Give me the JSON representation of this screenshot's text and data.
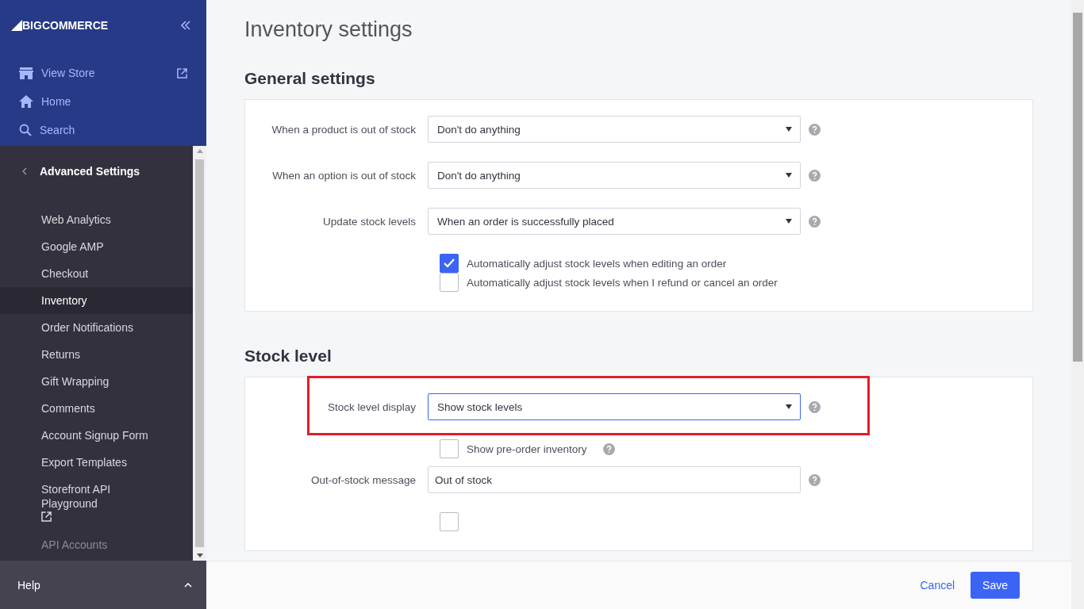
{
  "sidebar": {
    "logo": {
      "mark": "BIG",
      "word": "COMMERCE"
    },
    "top_links": [
      {
        "kind": "store",
        "label": "View Store"
      },
      {
        "kind": "home",
        "label": "Home"
      },
      {
        "kind": "search",
        "label": "Search"
      }
    ],
    "section_title": "Advanced Settings",
    "items": [
      {
        "label": "Web Analytics",
        "selected": false,
        "disabled": false,
        "external": false
      },
      {
        "label": "Google AMP",
        "selected": false,
        "disabled": false,
        "external": false
      },
      {
        "label": "Checkout",
        "selected": false,
        "disabled": false,
        "external": false
      },
      {
        "label": "Inventory",
        "selected": true,
        "disabled": false,
        "external": false
      },
      {
        "label": "Order Notifications",
        "selected": false,
        "disabled": false,
        "external": false
      },
      {
        "label": "Returns",
        "selected": false,
        "disabled": false,
        "external": false
      },
      {
        "label": "Gift Wrapping",
        "selected": false,
        "disabled": false,
        "external": false
      },
      {
        "label": "Comments",
        "selected": false,
        "disabled": false,
        "external": false
      },
      {
        "label": "Account Signup Form",
        "selected": false,
        "disabled": false,
        "external": false
      },
      {
        "label": "Export Templates",
        "selected": false,
        "disabled": false,
        "external": false
      },
      {
        "label": "Storefront API Playground",
        "selected": false,
        "disabled": false,
        "external": true
      },
      {
        "label": "API Accounts",
        "selected": false,
        "disabled": true,
        "external": false
      }
    ],
    "help": {
      "label": "Help",
      "expanded": false
    }
  },
  "page_title": "Inventory settings",
  "sections": [
    {
      "title": "General settings",
      "rows": [
        {
          "kind": "select",
          "label": "When a product is out of stock",
          "value": "Don't do anything"
        },
        {
          "kind": "select",
          "label": "When an option is out of stock",
          "value": "Don't do anything"
        },
        {
          "kind": "select",
          "label": "Update stock levels",
          "value": "When an order is successfully placed"
        },
        {
          "kind": "checkbox",
          "label": "Automatically adjust stock levels when editing an order",
          "checked": true
        },
        {
          "kind": "checkbox",
          "label": "Automatically adjust stock levels when I refund or cancel an order",
          "checked": false
        }
      ]
    },
    {
      "title": "Stock level",
      "rows": [
        {
          "kind": "select",
          "label": "Stock level display",
          "value": "Show stock levels",
          "highlighted": true
        },
        {
          "kind": "checkbox",
          "label": "Show pre-order inventory",
          "checked": false,
          "help": true
        },
        {
          "kind": "text",
          "label": "Out-of-stock message",
          "value": "Out of stock"
        },
        {
          "kind": "checkbox",
          "checked": false
        }
      ]
    }
  ],
  "footer": {
    "cancel": "Cancel",
    "save": "Save"
  }
}
